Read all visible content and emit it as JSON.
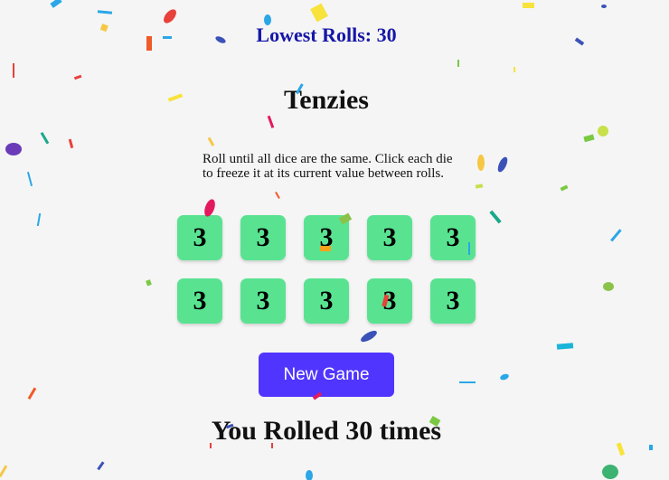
{
  "game": {
    "best_label": "Lowest Rolls: 30",
    "title": "Tenzies",
    "instructions": "Roll until all dice are the same. Click each die to freeze it at its current value between rolls.",
    "dice": [
      {
        "value": "3",
        "held": true
      },
      {
        "value": "3",
        "held": true
      },
      {
        "value": "3",
        "held": true
      },
      {
        "value": "3",
        "held": true
      },
      {
        "value": "3",
        "held": true
      },
      {
        "value": "3",
        "held": true
      },
      {
        "value": "3",
        "held": true
      },
      {
        "value": "3",
        "held": true
      },
      {
        "value": "3",
        "held": true
      },
      {
        "value": "3",
        "held": true
      }
    ],
    "new_game_label": "New Game",
    "rolled_text": "You Rolled 30 times"
  },
  "colors": {
    "held_die": "#59e391",
    "button": "#5035ff",
    "best_text": "#1616a8",
    "background": "#f5f5f5"
  }
}
